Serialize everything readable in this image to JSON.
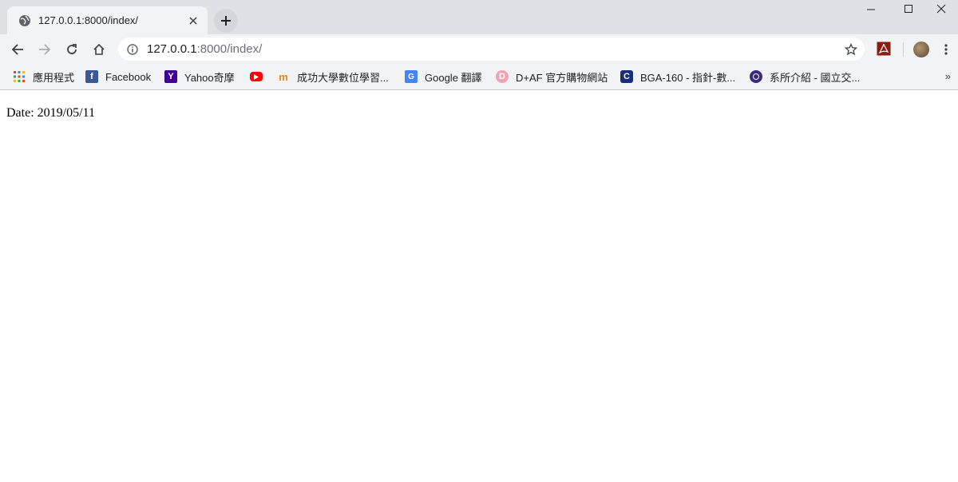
{
  "tab": {
    "title": "127.0.0.1:8000/index/"
  },
  "omnibox": {
    "host": "127.0.0.1",
    "rest": ":8000/index/"
  },
  "bookmarks": [
    {
      "label": "應用程式",
      "icon": "apps-grid-icon"
    },
    {
      "label": "Facebook",
      "icon": "facebook-icon"
    },
    {
      "label": "Yahoo奇摩",
      "icon": "yahoo-icon"
    },
    {
      "label": "",
      "icon": "youtube-icon"
    },
    {
      "label": "成功大學數位學習...",
      "icon": "moodle-icon"
    },
    {
      "label": "Google 翻譯",
      "icon": "google-translate-icon"
    },
    {
      "label": "D+AF 官方購物網站",
      "icon": "daf-icon"
    },
    {
      "label": "BGA-160 - 指針-數...",
      "icon": "casio-icon"
    },
    {
      "label": "系所介紹 - 國立交...",
      "icon": "university-seal-icon"
    }
  ],
  "bookmarks_more": "»",
  "page": {
    "date_text": "Date: 2019/05/11"
  }
}
